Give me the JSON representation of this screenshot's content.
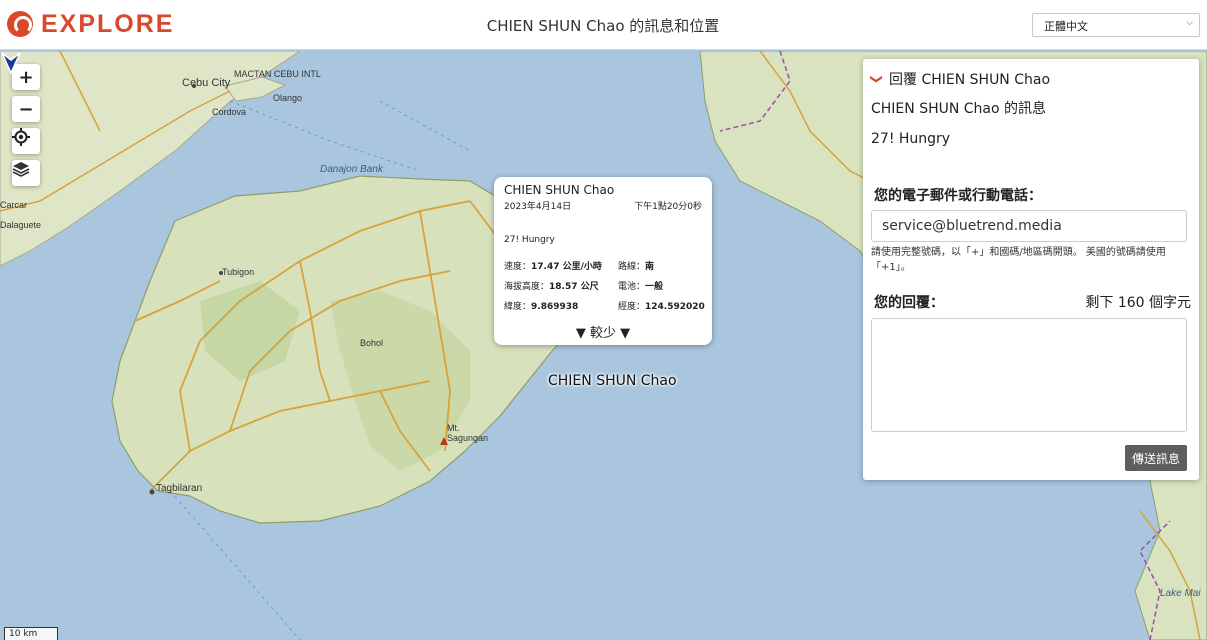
{
  "header": {
    "logo_text": "EXPLORE",
    "title": "CHIEN SHUN Chao 的訊息和位置",
    "language": "正體中文"
  },
  "map": {
    "places": {
      "mactan": "MACTAN CEBU INTL",
      "cebu_city": "Cebu City",
      "cordova": "Cordova",
      "olango": "Olango",
      "danajon": "Danajon Bank",
      "carcar": "Carcar",
      "dalaguete": "Dalaguete",
      "bohol": "Bohol",
      "tubigon": "Tubigon",
      "mt_sagungan": "Mt. Sagungan",
      "tagbilaran": "Tagbilaran",
      "lake_mainit": "Lake Mai"
    },
    "scale": "10 km",
    "marker_label": "CHIEN SHUN Chao"
  },
  "popup": {
    "name": "CHIEN SHUN Chao",
    "date": "2023年4月14日",
    "time": "下午1點20分0秒",
    "message": "27! Hungry",
    "speed_label": "速度：",
    "speed_value": "17.47 公里/小時",
    "heading_label": "路線：",
    "heading_value": "南",
    "altitude_label": "海拔高度：",
    "altitude_value": "18.57 公尺",
    "battery_label": "電池：",
    "battery_value": "一般",
    "lat_label": "緯度：",
    "lat_value": "9.869938",
    "lon_label": "經度：",
    "lon_value": "124.592020",
    "less_label": "▼ 較少 ▼"
  },
  "panel": {
    "reply_title": "回覆 CHIEN SHUN Chao",
    "message_title": "CHIEN SHUN Chao 的訊息",
    "message_body": "27! Hungry",
    "email_label": "您的電子郵件或行動電話：",
    "email_value": "service@bluetrend.media",
    "hint": "請使用完整號碼，以「+」和國碼/地區碼開頭。 美國的號碼請使用「+1」。",
    "reply_label": "您的回覆：",
    "remaining": "剩下 160 個字元",
    "send_label": "傳送訊息"
  }
}
